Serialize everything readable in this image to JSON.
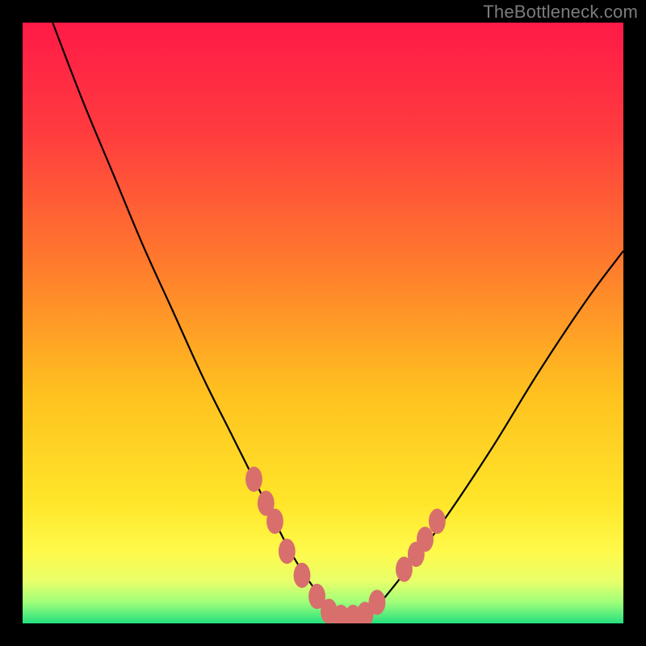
{
  "watermark": "TheBottleneck.com",
  "colors": {
    "frame": "#000000",
    "gradient_stops": [
      {
        "offset": 0.0,
        "color": "#ff1a47"
      },
      {
        "offset": 0.18,
        "color": "#ff3b3f"
      },
      {
        "offset": 0.4,
        "color": "#ff7a2d"
      },
      {
        "offset": 0.62,
        "color": "#ffc21f"
      },
      {
        "offset": 0.8,
        "color": "#ffe62a"
      },
      {
        "offset": 0.88,
        "color": "#fff94a"
      },
      {
        "offset": 0.93,
        "color": "#e8ff6a"
      },
      {
        "offset": 0.965,
        "color": "#9fff7a"
      },
      {
        "offset": 1.0,
        "color": "#25e07e"
      }
    ],
    "curve": "#000000",
    "spot_fill": "#d86f6c",
    "spot_stroke": "#b04f4c"
  },
  "chart_data": {
    "type": "line",
    "title": "",
    "xlabel": "",
    "ylabel": "",
    "xlim": [
      0,
      100
    ],
    "ylim": [
      0,
      100
    ],
    "grid": false,
    "legend": false,
    "series": [
      {
        "name": "curve",
        "x": [
          5,
          10,
          15,
          20,
          25,
          30,
          35,
          40,
          44,
          47,
          50,
          52,
          54,
          56,
          58,
          60,
          64,
          70,
          78,
          86,
          94,
          100
        ],
        "y": [
          100,
          87,
          75,
          63,
          52,
          41,
          31,
          21,
          13,
          8,
          4,
          2,
          1,
          1,
          2,
          4,
          9,
          17,
          29,
          42,
          54,
          62
        ]
      }
    ],
    "spots": {
      "name": "highlighted-points",
      "points": [
        {
          "x": 38.5,
          "y": 24
        },
        {
          "x": 40.5,
          "y": 20
        },
        {
          "x": 42.0,
          "y": 17
        },
        {
          "x": 44.0,
          "y": 12
        },
        {
          "x": 46.5,
          "y": 8
        },
        {
          "x": 49.0,
          "y": 4.5
        },
        {
          "x": 51.0,
          "y": 2
        },
        {
          "x": 53.0,
          "y": 1
        },
        {
          "x": 55.0,
          "y": 1
        },
        {
          "x": 57.0,
          "y": 1.5
        },
        {
          "x": 59.0,
          "y": 3.5
        },
        {
          "x": 63.5,
          "y": 9
        },
        {
          "x": 65.5,
          "y": 11.5
        },
        {
          "x": 67.0,
          "y": 14
        },
        {
          "x": 69.0,
          "y": 17
        }
      ],
      "rx": 1.4,
      "ry": 2.1
    }
  }
}
